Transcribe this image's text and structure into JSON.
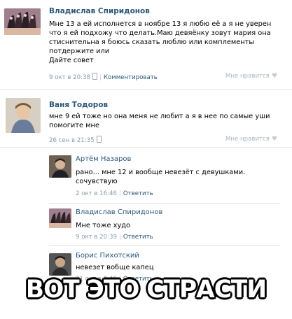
{
  "posts": [
    {
      "author": "Владислав Спиридонов",
      "lines": [
        "Мне 13 а ей исполнется в ноябре 13 я любю её а я не уверен",
        "что я ей подхожу что делать.Маю девяёнку зовут мария она",
        "стиснительна я боюсь сказать люблю или комплементы",
        "потдержите или",
        "Дайте совет"
      ],
      "date": "9 окт в 20:38",
      "action": "Комментировать",
      "like": "Мне нравится"
    },
    {
      "author": "Ваня Тодоров",
      "lines": [
        "мне 9 ей тоже но она меня не любит а я в нее по самые уши",
        "помогите мне"
      ],
      "date": "26 сен в 21:35",
      "like": "Мне нравится"
    }
  ],
  "comments": [
    {
      "author": "Артём Назаров",
      "lines": [
        "рано... мне 12 и вообще невезёт с девушками.",
        "сочувствую"
      ],
      "date": "2 окт в 16:46",
      "action": "Ответить"
    },
    {
      "author": "Владислав Спиридонов",
      "lines": [
        "Мне тоже худо"
      ],
      "date": "9 окт в 20:39",
      "action": "Ответить"
    },
    {
      "author": "Борис Пихотский",
      "lines": [
        "невезет вобще капец"
      ],
      "date": "21 окт в 0:46",
      "action": "Ответить"
    }
  ],
  "caption": "ВОТ ЭТО СТРАСТИ",
  "colors": {
    "link": "#2b587a",
    "meta": "#8a9aa9",
    "separator": "#dfe4ea"
  }
}
